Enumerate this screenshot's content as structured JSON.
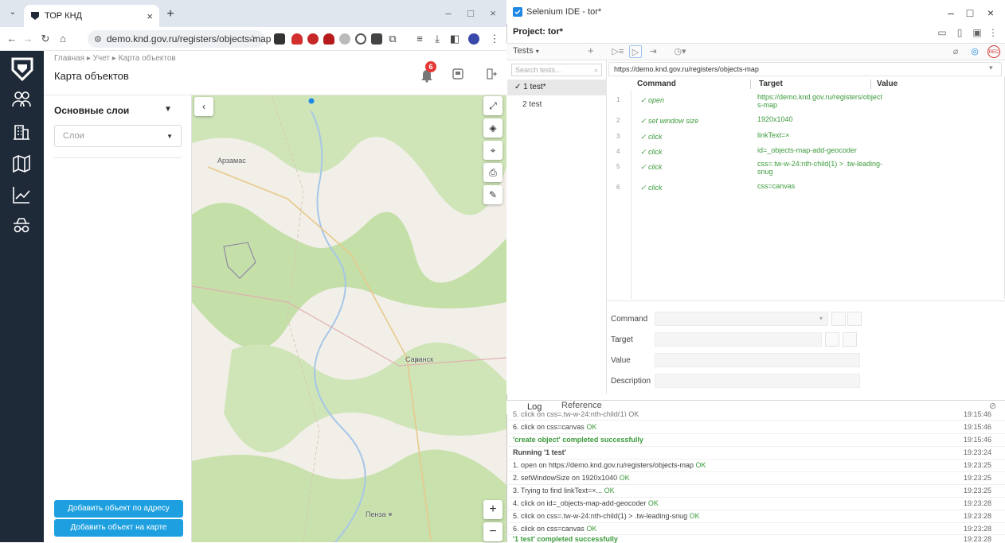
{
  "chrome": {
    "tab_title": "ТОР КНД",
    "tab_close": "×",
    "new_tab": "+",
    "url": "demo.knd.gov.ru/registers/objects-map",
    "win_min": "–",
    "win_max": "□",
    "win_close": "×"
  },
  "app": {
    "breadcrumb": "Главная  ▸  Учет  ▸  Карта объектов",
    "page_title": "Карта объектов",
    "notifications_count": "6",
    "layers_heading": "Основные слои",
    "layers_placeholder": "Слои",
    "btn_add_by_address": "Добавить объект по адресу",
    "btn_add_on_map": "Добавить объект на карте",
    "map_labels": {
      "arzamas": "Арзамас",
      "saransk": "Саранск",
      "penza": "Пенза"
    },
    "zoom_in": "+",
    "zoom_out": "−",
    "collapse": "‹"
  },
  "ide": {
    "title": "Selenium IDE - tor*",
    "project": "Project:  tor*",
    "tests_label": "Tests",
    "tests_plus": "+",
    "search_placeholder": "Search tests...",
    "tests": [
      "✓ 1 test*",
      "2 test"
    ],
    "base_url": "https://demo.knd.gov.ru/registers/objects-map",
    "col_command": "Command",
    "col_target": "Target",
    "col_value": "Value",
    "commands": [
      {
        "n": "1",
        "cmd": "✓ open",
        "target": "https://demo.knd.gov.ru/registers/object\ns-map"
      },
      {
        "n": "2",
        "cmd": "✓ set window size",
        "target": "1920x1040"
      },
      {
        "n": "3",
        "cmd": "✓ click",
        "target": "linkText=×"
      },
      {
        "n": "4",
        "cmd": "✓ click",
        "target": "id=_objects-map-add-geocoder"
      },
      {
        "n": "5",
        "cmd": "✓ click",
        "target": "css=.tw-w-24:nth-child(1) > .tw-leading-\nsnug"
      },
      {
        "n": "6",
        "cmd": "✓ click",
        "target": "css=canvas"
      }
    ],
    "form": {
      "command": "Command",
      "target": "Target",
      "value": "Value",
      "description": "Description"
    },
    "log_tab": "Log",
    "reference_tab": "Reference",
    "log": [
      {
        "text": "5.  click on css=.tw-w-24:nth-child(1) OK",
        "time": "19:15:46",
        "kind": "cut"
      },
      {
        "text": "6.  click on css=canvas",
        "ok": "OK",
        "time": "19:15:46",
        "kind": "line"
      },
      {
        "text": "'create object' completed successfully",
        "time": "19:15:46",
        "kind": "done"
      },
      {
        "text": "Running '1 test'",
        "time": "19:23:24",
        "kind": "run"
      },
      {
        "text": "1.  open on https://demo.knd.gov.ru/registers/objects-map",
        "ok": "OK",
        "time": "19:23:25",
        "kind": "line"
      },
      {
        "text": "2.  setWindowSize on 1920x1040",
        "ok": "OK",
        "time": "19:23:25",
        "kind": "line"
      },
      {
        "text": "3.  Trying to find linkText=×...",
        "ok": "OK",
        "time": "19:23:25",
        "kind": "line"
      },
      {
        "text": "4.  click on id=_objects-map-add-geocoder",
        "ok": "OK",
        "time": "19:23:28",
        "kind": "line"
      },
      {
        "text": "5.  click on css=.tw-w-24:nth-child(1) > .tw-leading-snug",
        "ok": "OK",
        "time": "19:23:28",
        "kind": "line"
      },
      {
        "text": "6.  click on css=canvas",
        "ok": "OK",
        "time": "19:23:28",
        "kind": "line"
      },
      {
        "text": "'1 test' completed successfully",
        "time": "19:23:28",
        "kind": "done"
      }
    ],
    "win_min": "–",
    "win_max": "□",
    "win_close": "×"
  }
}
